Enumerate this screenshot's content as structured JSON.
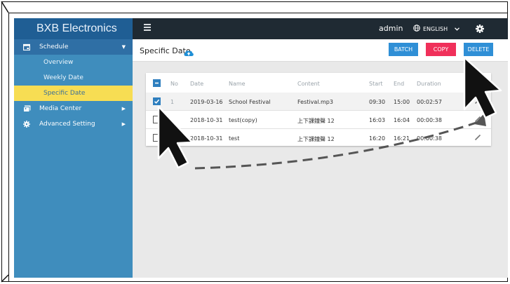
{
  "brand": "BXB Electronics",
  "topbar": {
    "user": "admin",
    "language": "ENGLISH"
  },
  "sidebar": {
    "schedule": "Schedule",
    "sub_items": [
      "Overview",
      "Weekly Date",
      "Specific Date"
    ],
    "media_center": "Media Center",
    "advanced_setting": "Advanced Setting"
  },
  "header": {
    "title": "Specific Date",
    "batch": "BATCH",
    "copy": "COPY",
    "delete": "DELETE"
  },
  "table": {
    "columns": [
      "No",
      "Date",
      "Name",
      "Content",
      "Start",
      "End",
      "Duration"
    ],
    "rows": [
      {
        "no": "1",
        "date": "2019-03-16",
        "name": "School Festival",
        "content": "Festival.mp3",
        "start": "09:30",
        "end": "15:00",
        "duration": "00:02:57",
        "checked": true
      },
      {
        "no": "",
        "date": "2018-10-31",
        "name": "test(copy)",
        "content": "上下課鐘聲 12",
        "start": "16:03",
        "end": "16:04",
        "duration": "00:00:38",
        "checked": false
      },
      {
        "no": "",
        "date": "2018-10-31",
        "name": "test",
        "content": "上下課鐘聲 12",
        "start": "16:20",
        "end": "16:21",
        "duration": "00:00:38",
        "checked": false
      }
    ]
  },
  "colors": {
    "sidebar": "#3f8dbd",
    "brand_bar": "#1f5e94",
    "active_item": "#f7dd53",
    "topbar": "#1f2a33",
    "button_blue": "#2f8fd6",
    "button_red": "#f0305a"
  }
}
